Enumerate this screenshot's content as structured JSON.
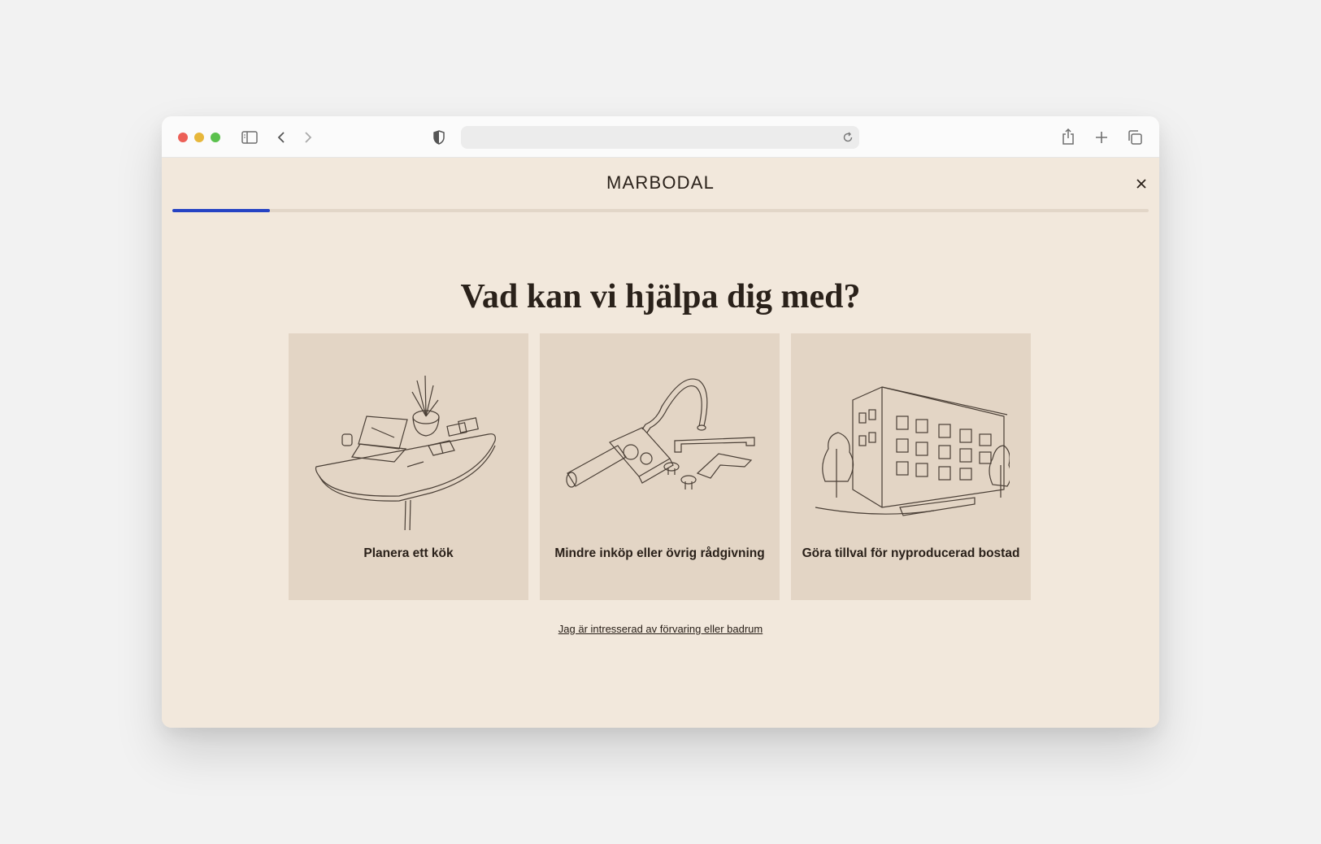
{
  "browser": {
    "icons": [
      "sidebar-icon",
      "back-icon",
      "forward-icon",
      "shield-icon",
      "reload-icon",
      "share-icon",
      "new-tab-icon",
      "tabs-overview-icon"
    ],
    "address": ""
  },
  "header": {
    "logo": "MARBODAL",
    "close_icon": "close-icon",
    "progress": 0.1
  },
  "main": {
    "heading": "Vad kan vi hjälpa dig med?",
    "cards": [
      {
        "label": "Planera ett kök",
        "icon": "kitchen-table-illustration"
      },
      {
        "label": "Mindre inköp eller övrig rådgivning",
        "icon": "faucet-handles-illustration"
      },
      {
        "label": "Göra tillval för nyproducerad bostad",
        "icon": "apartment-building-illustration"
      }
    ],
    "secondary_link": "Jag är intresserad av förvaring eller badrum"
  },
  "colors": {
    "page_bg": "#f2e8dc",
    "card_bg": "#e3d5c5",
    "accent": "#2643c4",
    "text": "#2a211a"
  }
}
